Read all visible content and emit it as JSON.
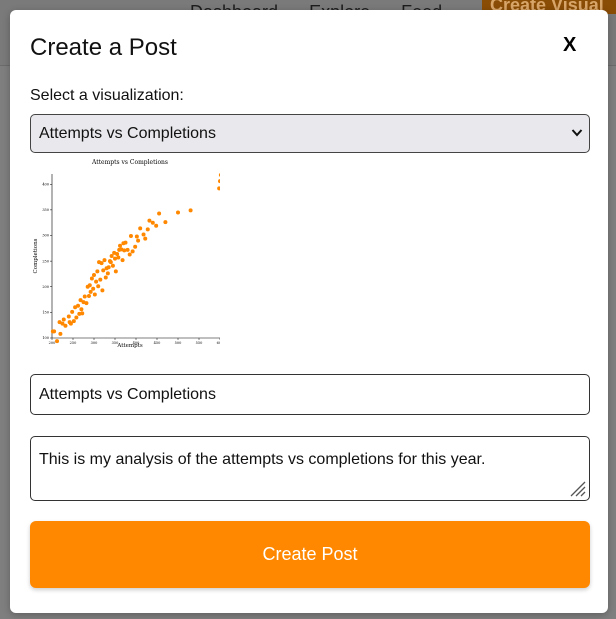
{
  "background": {
    "nav_items": [
      "Dashboard",
      "Explore",
      "Feed"
    ],
    "cta_label": "Create Visual"
  },
  "modal": {
    "title": "Create a Post",
    "close_label": "X",
    "select_label": "Select a visualization:",
    "selected_visualization": "Attempts vs Completions",
    "title_value": "Attempts vs Completions",
    "description_value": "This is my analysis of the attempts vs completions for this year.",
    "submit_label": "Create Post"
  },
  "colors": {
    "accent": "#ff8800",
    "point": "#ff8800"
  },
  "chart_data": {
    "type": "scatter",
    "title": "Attempts vs Completions",
    "xlabel": "Attempts",
    "ylabel": "Completions",
    "xlim": [
      200,
      600
    ],
    "ylim": [
      100,
      420
    ],
    "xticks": [
      "200",
      "250",
      "300",
      "350",
      "400",
      "450",
      "500",
      "550",
      "600"
    ],
    "yticks": [
      "100",
      "150",
      "200",
      "250",
      "300",
      "350",
      "400"
    ],
    "x": [
      202,
      205,
      212,
      218,
      220,
      225,
      228,
      232,
      240,
      242,
      245,
      248,
      252,
      255,
      258,
      262,
      265,
      268,
      270,
      272,
      275,
      278,
      282,
      285,
      288,
      290,
      292,
      295,
      298,
      300,
      302,
      305,
      308,
      310,
      312,
      315,
      318,
      320,
      322,
      325,
      328,
      330,
      333,
      335,
      338,
      340,
      342,
      345,
      348,
      350,
      352,
      355,
      358,
      360,
      362,
      365,
      368,
      370,
      372,
      375,
      380,
      385,
      388,
      392,
      398,
      402,
      405,
      410,
      418,
      422,
      428,
      432,
      440,
      448,
      455,
      470,
      500,
      530,
      598,
      600,
      602
    ],
    "y": [
      113,
      113,
      94,
      131,
      108,
      128,
      136,
      124,
      142,
      131,
      128,
      151,
      133,
      160,
      140,
      163,
      147,
      174,
      156,
      148,
      170,
      181,
      168,
      200,
      182,
      203,
      190,
      216,
      196,
      223,
      185,
      210,
      230,
      201,
      248,
      214,
      246,
      193,
      232,
      252,
      218,
      236,
      226,
      238,
      250,
      248,
      260,
      241,
      266,
      255,
      230,
      264,
      257,
      272,
      280,
      273,
      252,
      285,
      271,
      286,
      272,
      263,
      299,
      269,
      278,
      298,
      290,
      314,
      302,
      294,
      312,
      329,
      325,
      319,
      343,
      326,
      345,
      349,
      392,
      406,
      418
    ]
  }
}
